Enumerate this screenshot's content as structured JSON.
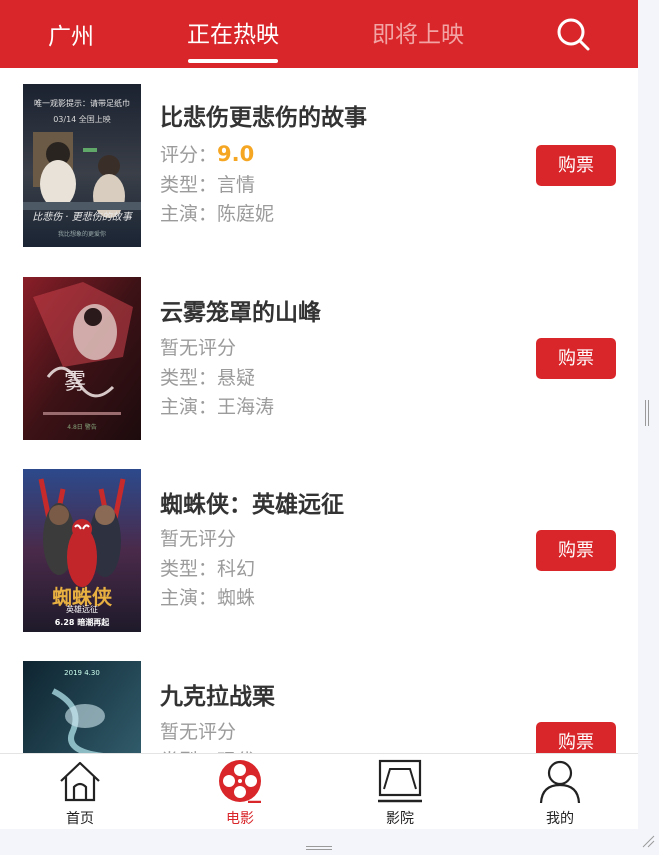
{
  "header": {
    "city": "广州",
    "tabs": [
      {
        "label": "正在热映",
        "active": true
      },
      {
        "label": "即将上映",
        "active": false
      }
    ],
    "search_icon": "search-icon"
  },
  "movies": [
    {
      "title": "比悲伤更悲伤的故事",
      "score_label": "评分：",
      "score": "9.0",
      "genre": "类型：言情",
      "cast": "主演：陈庭妮",
      "buy_label": "购票",
      "poster_text": {
        "top": "唯一观影提示：请带足纸巾",
        "date": "03/14 全国上映"
      }
    },
    {
      "title": "云雾笼罩的山峰",
      "score_text": "暂无评分",
      "genre": "类型：悬疑",
      "cast": "主演：王海涛",
      "buy_label": "购票"
    },
    {
      "title": "蜘蛛侠：英雄远征",
      "score_text": "暂无评分",
      "genre": "类型：科幻",
      "cast": "主演：蜘蛛",
      "buy_label": "购票",
      "poster_text": {
        "name": "蜘蛛侠",
        "sub": "英雄远征",
        "date": "6.28 暗潮再起"
      }
    },
    {
      "title": "九克拉战栗",
      "score_text": "暂无评分",
      "genre": "类型：现代",
      "cast": "",
      "buy_label": "购票"
    }
  ],
  "bottom_nav": [
    {
      "label": "首页",
      "icon": "home-icon",
      "active": false
    },
    {
      "label": "电影",
      "icon": "film-reel-icon",
      "active": true
    },
    {
      "label": "影院",
      "icon": "cinema-screen-icon",
      "active": false
    },
    {
      "label": "我的",
      "icon": "user-icon",
      "active": false
    }
  ],
  "colors": {
    "brand": "#d9262a",
    "score": "#f5a623",
    "muted": "#9b9b9b"
  }
}
